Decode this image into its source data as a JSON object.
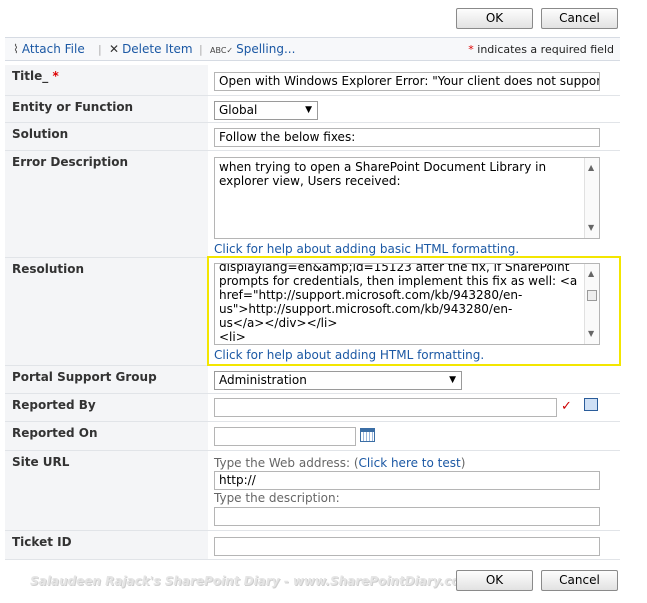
{
  "buttons": {
    "ok": "OK",
    "cancel": "Cancel"
  },
  "toolbar": {
    "attach_file": "Attach File",
    "delete_item": "Delete Item",
    "spelling": "Spelling...",
    "required_note": "indicates a required field",
    "required_star": "*"
  },
  "fields": {
    "title": {
      "label": "Title_",
      "star": "*",
      "value": "Open with Windows Explorer Error: \"Your client does not support o"
    },
    "entity": {
      "label": "Entity or Function",
      "value": "Global"
    },
    "solution": {
      "label": "Solution",
      "value": "Follow the below fixes:"
    },
    "error_description": {
      "label": "Error Description",
      "lines": [
        "when trying to open a SharePoint Document Library in",
        "explorer view, Users received:"
      ],
      "help": "Click for help about adding basic HTML formatting."
    },
    "resolution": {
      "label": "Resolution",
      "lines": [
        "displaylang=en&amp;id=15123 after the fix, if SharePoint",
        "prompts for credentials, then implement this fix as well: <a",
        "href=\"http://support.microsoft.com/kb/943280/en-",
        "us\">http://support.microsoft.com/kb/943280/en-",
        "us</a></div></li>",
        "<li>"
      ],
      "help": "Click for help about adding HTML formatting."
    },
    "portal_support_group": {
      "label": "Portal Support Group",
      "value": "Administration"
    },
    "reported_by": {
      "label": "Reported By",
      "value": ""
    },
    "reported_on": {
      "label": "Reported On",
      "value": ""
    },
    "site_url": {
      "label": "Site URL",
      "address_hint": "Type the Web address: (",
      "test_link": "Click here to test",
      "address_hint_end": ")",
      "address_value": "http://",
      "description_hint": "Type the description:",
      "description_value": ""
    },
    "ticket_id": {
      "label": "Ticket ID",
      "value": ""
    }
  },
  "watermark": "Salaudeen Rajack's SharePoint Diary - www.SharePointDiary.com",
  "icons": {
    "attach": "paperclip-icon",
    "delete": "delete-x-icon",
    "spelling": "spelling-abc-icon",
    "check_names": "check-names-icon",
    "browse": "address-book-icon",
    "calendar": "calendar-icon"
  }
}
